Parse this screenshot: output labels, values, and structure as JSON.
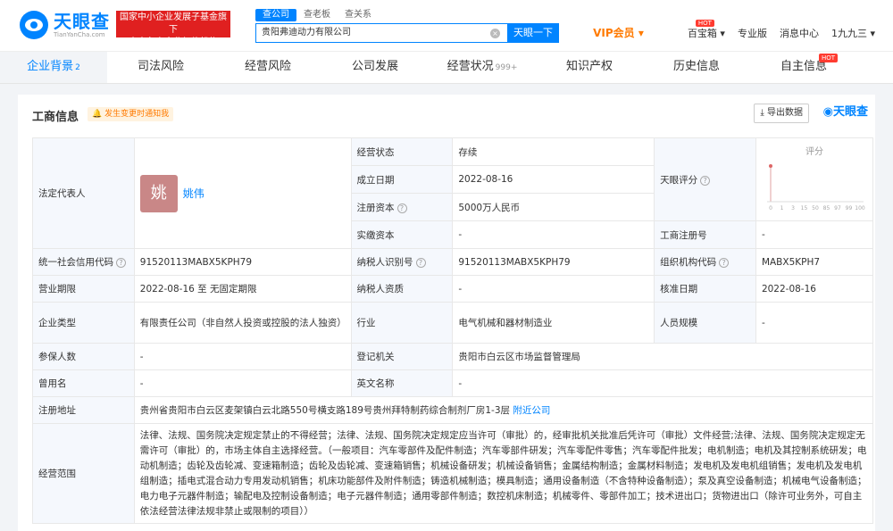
{
  "header": {
    "logo_cn": "天眼查",
    "logo_en": "TianYanCha.com",
    "banner_line1": "国家中小企业发展子基金旗下",
    "banner_line2": "官方备案企业征信机构",
    "search_tabs": [
      "查公司",
      "查老板",
      "查关系"
    ],
    "search_value": "贵阳弗迪动力有限公司",
    "search_button": "天眼一下",
    "nav": {
      "vip": "VIP会员",
      "baibaoxiang": "百宝箱",
      "hot": "HOT",
      "pro": "专业版",
      "msg": "消息中心",
      "user": "1九九三"
    }
  },
  "tabs": [
    {
      "label": "企业背景",
      "count": "2"
    },
    {
      "label": "司法风险",
      "count": ""
    },
    {
      "label": "经营风险",
      "count": ""
    },
    {
      "label": "公司发展",
      "count": ""
    },
    {
      "label": "经营状况",
      "count": "999+"
    },
    {
      "label": "知识产权",
      "count": ""
    },
    {
      "label": "历史信息",
      "count": ""
    },
    {
      "label": "自主信息",
      "count": ""
    }
  ],
  "tab_hot": "HOT",
  "section": {
    "title": "工商信息",
    "notify": "发生变更时通知我",
    "export": "导出数据",
    "brand": "天眼查"
  },
  "info": {
    "legal_rep_label": "法定代表人",
    "avatar_char": "姚",
    "legal_rep": "姚伟",
    "status_label": "经营状态",
    "status": "存续",
    "founded_label": "成立日期",
    "founded": "2022-08-16",
    "capital_label": "注册资本",
    "capital": "5000万人民币",
    "paid_label": "实缴资本",
    "paid": "-",
    "score_label": "天眼评分",
    "score_title": "评分",
    "score_ticks": [
      "0",
      "1",
      "3",
      "15",
      "50",
      "85",
      "97",
      "99",
      "100"
    ],
    "reg_no_label": "工商注册号",
    "reg_no": "-",
    "credit_label": "统一社会信用代码",
    "credit": "91520113MABX5KPH79",
    "taxid_label": "纳税人识别号",
    "taxid": "91520113MABX5KPH79",
    "org_label": "组织机构代码",
    "org": "MABX5KPH7",
    "term_label": "营业期限",
    "term": "2022-08-16 至 无固定期限",
    "taxq_label": "纳税人资质",
    "taxq": "-",
    "approve_label": "核准日期",
    "approve": "2022-08-16",
    "type_label": "企业类型",
    "type": "有限责任公司（非自然人投资或控股的法人独资）",
    "industry_label": "行业",
    "industry": "电气机械和器材制造业",
    "staff_label": "人员规模",
    "staff": "-",
    "insured_label": "参保人数",
    "insured": "-",
    "authority_label": "登记机关",
    "authority": "贵阳市白云区市场监督管理局",
    "former_label": "曾用名",
    "former": "-",
    "en_label": "英文名称",
    "en": "-",
    "address_label": "注册地址",
    "address": "贵州省贵阳市白云区麦架镇白云北路550号横支路189号贵州拜特制药综合制剂厂房1-3层",
    "nearby": "附近公司",
    "scope_label": "经营范围",
    "scope": "法律、法规、国务院决定规定禁止的不得经营；法律、法规、国务院决定规定应当许可（审批）的，经审批机关批准后凭许可（审批）文件经营;法律、法规、国务院决定规定无需许可（审批）的，市场主体自主选择经营。（一般项目：汽车零部件及配件制造；汽车零部件研发；汽车零配件零售；汽车零配件批发；电机制造；电机及其控制系统研发；电动机制造；齿轮及齿轮减、变速箱制造；齿轮及齿轮减、变速箱销售；机械设备研发；机械设备销售；金属结构制造；金属材料制造；发电机及发电机组销售；发电机及发电机组制造；插电式混合动力专用发动机销售；机床功能部件及附件制造；铸造机械制造；模具制造；通用设备制造（不含特种设备制造）；泵及真空设备制造；机械电气设备制造；电力电子元器件制造；输配电及控制设备制造；电子元器件制造；通用零部件制造；数控机床制造；机械零件、零部件加工；技术进出口；货物进出口（除许可业务外，可自主依法经营法律法规非禁止或限制的项目））"
  }
}
